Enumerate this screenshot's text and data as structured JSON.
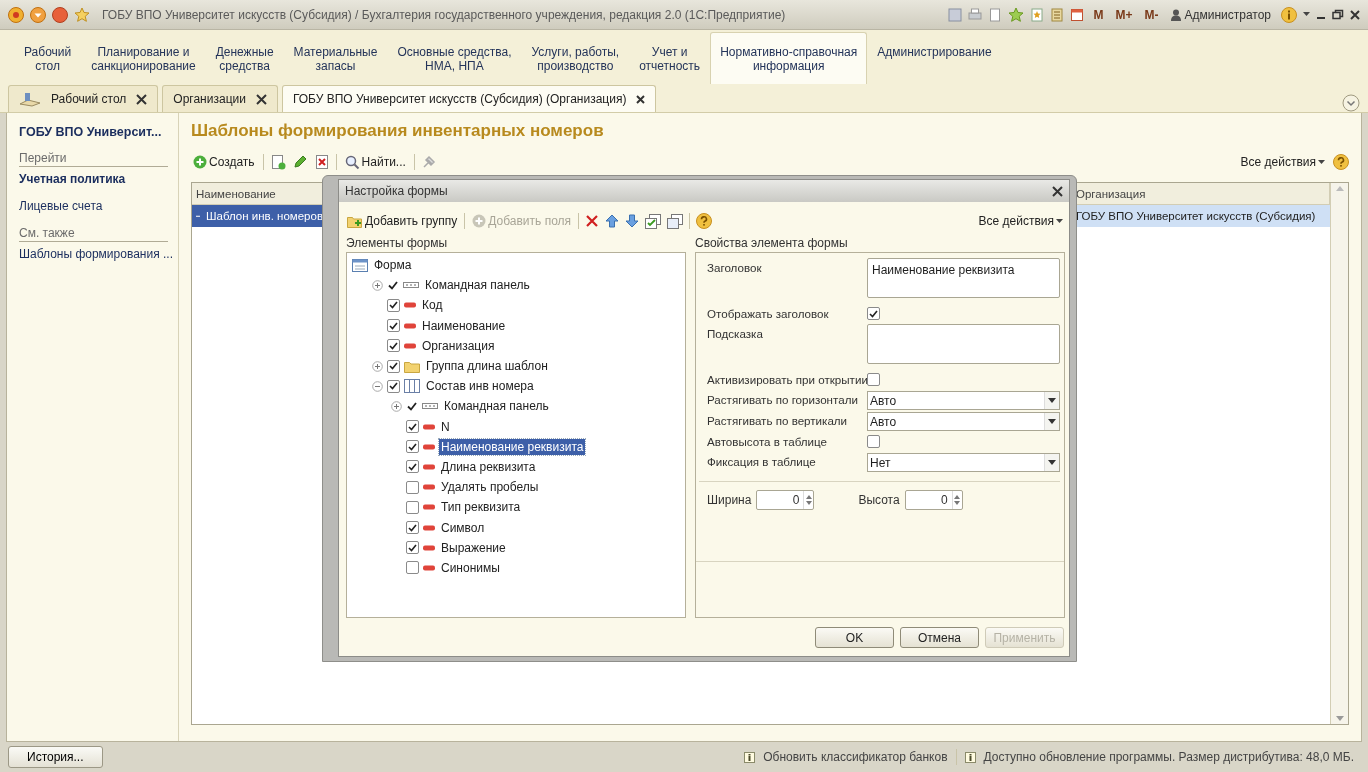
{
  "window": {
    "title": "ГОБУ ВПО Университет искусств (Субсидия) / Бухгалтерия государственного учреждения, редакция 2.0  (1С:Предприятие)",
    "memory_buttons": [
      "M",
      "M+",
      "M-"
    ],
    "user": "Администратор"
  },
  "sections": [
    {
      "lines": [
        "Рабочий",
        "стол"
      ],
      "selected": false
    },
    {
      "lines": [
        "Планирование и",
        "санкционирование"
      ],
      "selected": false
    },
    {
      "lines": [
        "Денежные",
        "средства"
      ],
      "selected": false
    },
    {
      "lines": [
        "Материальные",
        "запасы"
      ],
      "selected": false
    },
    {
      "lines": [
        "Основные средства,",
        "НМА, НПА"
      ],
      "selected": false
    },
    {
      "lines": [
        "Услуги, работы,",
        "производство"
      ],
      "selected": false
    },
    {
      "lines": [
        "Учет и",
        "отчетность"
      ],
      "selected": false
    },
    {
      "lines": [
        "Нормативно-справочная",
        "информация"
      ],
      "selected": true
    },
    {
      "lines": [
        "Администрирование"
      ],
      "selected": false
    }
  ],
  "open_tabs": [
    {
      "label": "Рабочий стол",
      "kind": "desktop",
      "selected": false
    },
    {
      "label": "Организации",
      "kind": "form",
      "selected": false
    },
    {
      "label": "ГОБУ ВПО Университет искусств (Субсидия) (Организация)",
      "kind": "form",
      "selected": true
    }
  ],
  "sidebar": {
    "title": "ГОБУ ВПО Университ...",
    "groups": [
      {
        "heading": "Перейти",
        "items": [
          {
            "label": "Учетная политика",
            "selected": true
          },
          {
            "label": "Лицевые счета",
            "selected": false
          }
        ]
      },
      {
        "heading": "См. также",
        "items": [
          {
            "label": "Шаблоны формирования ...",
            "selected": false
          }
        ]
      }
    ]
  },
  "page": {
    "title": "Шаблоны формирования инвентарных номеров",
    "create": "Создать",
    "find": "Найти...",
    "all_actions": "Все действия",
    "table": {
      "columns": [
        "Наименование",
        "Организация"
      ],
      "rows": [
        {
          "cells": [
            "Шаблон инв. номеров",
            "ГОБУ ВПО Университет искусств (Субсидия)"
          ],
          "selected": true
        }
      ]
    }
  },
  "dialog": {
    "title": "Настройка формы",
    "add_group": "Добавить группу",
    "add_fields": {
      "label": "Добавить поля",
      "disabled": true
    },
    "all_actions": "Все действия",
    "tree_heading": "Элементы формы",
    "props_heading": "Свойства элемента формы",
    "tree": {
      "label": "Форма",
      "kind": "form",
      "selected": false,
      "children": [
        {
          "label": "Командная панель",
          "kind": "command_panel",
          "checked": true,
          "expanded": false,
          "selected": false
        },
        {
          "label": "Код",
          "kind": "field",
          "checked": true,
          "selected": false
        },
        {
          "label": "Наименование",
          "kind": "field",
          "checked": true,
          "selected": false
        },
        {
          "label": "Организация",
          "kind": "field",
          "checked": true,
          "selected": false
        },
        {
          "label": "Группа длина шаблон",
          "kind": "group",
          "checked": true,
          "expanded": false,
          "selected": false
        },
        {
          "label": "Состав инв номера",
          "kind": "table",
          "checked": true,
          "expanded": true,
          "selected": false,
          "children": [
            {
              "label": "Командная панель",
              "kind": "command_panel",
              "checked": true,
              "expanded": false,
              "selected": false
            },
            {
              "label": "N",
              "kind": "field",
              "checked": true,
              "selected": false
            },
            {
              "label": "Наименование реквизита",
              "kind": "field",
              "checked": true,
              "selected": true
            },
            {
              "label": "Длина реквизита",
              "kind": "field",
              "checked": true,
              "selected": false
            },
            {
              "label": "Удалять пробелы",
              "kind": "field",
              "checked": false,
              "selected": false
            },
            {
              "label": "Тип реквизита",
              "kind": "field",
              "checked": false,
              "selected": false
            },
            {
              "label": "Символ",
              "kind": "field",
              "checked": true,
              "selected": false
            },
            {
              "label": "Выражение",
              "kind": "field",
              "checked": true,
              "selected": false
            },
            {
              "label": "Синонимы",
              "kind": "field",
              "checked": false,
              "selected": false
            }
          ]
        }
      ]
    },
    "properties": [
      {
        "label": "Заголовок",
        "kind": "textarea",
        "value": "Наименование реквизита"
      },
      {
        "label": "Отображать заголовок",
        "kind": "checkbox",
        "checked": true
      },
      {
        "label": "Подсказка",
        "kind": "textarea"
      },
      {
        "label": "Активизировать при открытии",
        "kind": "checkbox",
        "checked": false
      },
      {
        "label": "Растягивать по горизонтали",
        "kind": "select",
        "value": "Авто"
      },
      {
        "label": "Растягивать по вертикали",
        "kind": "select",
        "value": "Авто"
      },
      {
        "label": "Автовысота в таблице",
        "kind": "checkbox",
        "checked": false
      },
      {
        "label": "Фиксация в таблице",
        "kind": "select",
        "value": "Нет"
      }
    ],
    "sizes": [
      {
        "label": "Ширина",
        "value": "0"
      },
      {
        "label": "Высота",
        "value": "0"
      }
    ],
    "buttons": [
      {
        "label": "OK",
        "disabled": false
      },
      {
        "label": "Отмена",
        "disabled": false
      },
      {
        "label": "Применить",
        "disabled": true
      }
    ]
  },
  "status_bar": {
    "history_button": "История...",
    "messages": [
      "Обновить классификатор банков",
      "Доступно обновление программы. Размер дистрибутива: 48,0 МБ."
    ]
  }
}
